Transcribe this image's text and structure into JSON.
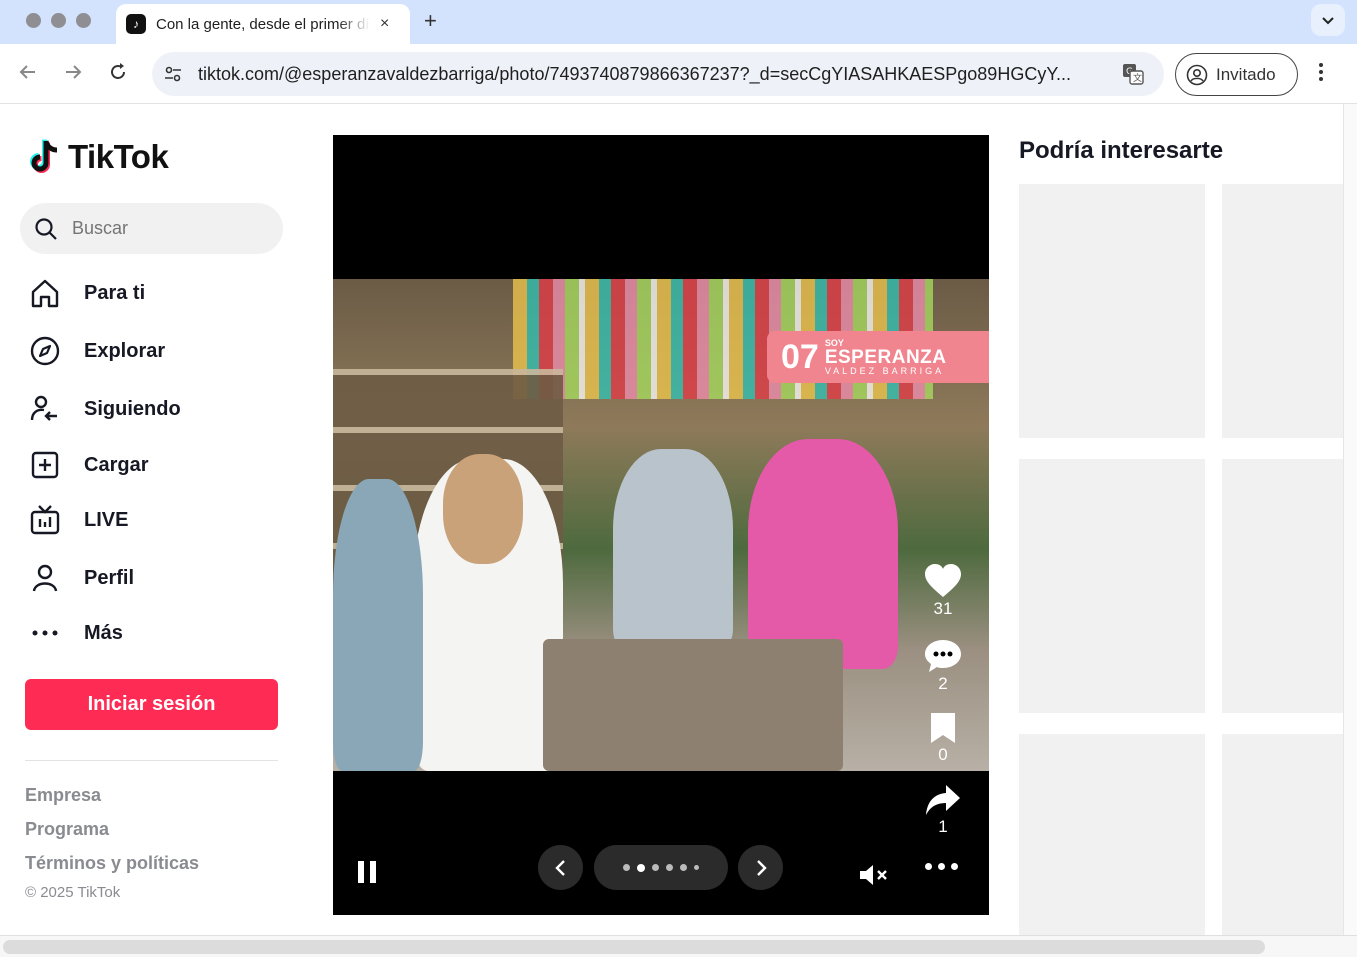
{
  "browser": {
    "tab_title": "Con la gente, desde el primer día",
    "tab_close": "×",
    "new_tab": "+",
    "url": "tiktok.com/@esperanzavaldezbarriga/photo/7493740879866367237?_d=secCgYIASAHKAESPgo89HGCyY...",
    "profile_label": "Invitado"
  },
  "sidebar": {
    "logo_text": "TikTok",
    "search_placeholder": "Buscar",
    "nav": [
      {
        "label": "Para ti",
        "icon": "home-icon"
      },
      {
        "label": "Explorar",
        "icon": "compass-icon"
      },
      {
        "label": "Siguiendo",
        "icon": "following-icon"
      },
      {
        "label": "Cargar",
        "icon": "upload-icon"
      },
      {
        "label": "LIVE",
        "icon": "live-icon"
      },
      {
        "label": "Perfil",
        "icon": "profile-icon"
      },
      {
        "label": "Más",
        "icon": "more-icon"
      }
    ],
    "login_label": "Iniciar sesión",
    "footer": [
      "Empresa",
      "Programa",
      "Términos y políticas"
    ],
    "copyright": "© 2025 TikTok"
  },
  "post": {
    "badge_number": "07",
    "badge_soy": "SOY",
    "badge_name": "ESPERANZA",
    "badge_sub": "VALDEZ BARRIGA",
    "likes": "31",
    "comments": "2",
    "saves": "0",
    "shares": "1",
    "carousel_pages": 6,
    "carousel_active": 2
  },
  "recommendations": {
    "title": "Podría interesarte"
  },
  "colors": {
    "brand": "#fe2c55",
    "badge": "#f1858f"
  }
}
